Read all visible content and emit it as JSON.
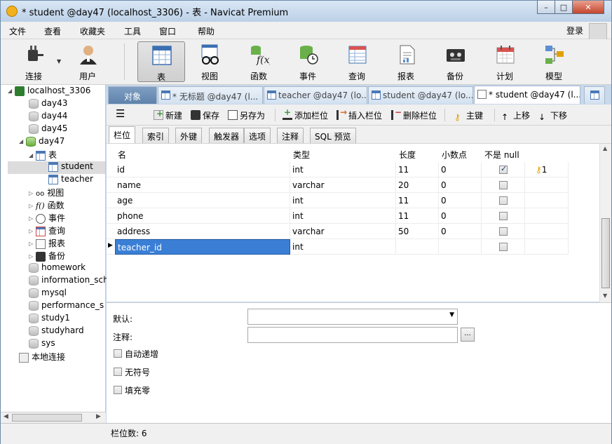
{
  "title": "* student @day47 (localhost_3306) - 表 - Navicat Premium",
  "window_controls": {
    "minimize": "–",
    "maximize": "□",
    "close": "✕"
  },
  "menu": [
    "文件",
    "查看",
    "收藏夹",
    "工具",
    "窗口",
    "帮助"
  ],
  "login_label": "登录",
  "toolbar": [
    "连接",
    "用户",
    "表",
    "视图",
    "函数",
    "事件",
    "查询",
    "报表",
    "备份",
    "计划",
    "模型"
  ],
  "toolbar_active": "表",
  "tree": {
    "connection": "localhost_3306",
    "databases_before": [
      "day43",
      "day44",
      "day45"
    ],
    "current_db": "day47",
    "tables_node": "表",
    "tables": [
      "student",
      "teacher"
    ],
    "selected_table": "student",
    "db_nodes": [
      "视图",
      "函数",
      "事件",
      "查询",
      "报表",
      "备份"
    ],
    "databases_after": [
      "homework",
      "information_sch",
      "mysql",
      "performance_s",
      "study1",
      "studyhard",
      "sys"
    ],
    "local": "本地连接"
  },
  "tabs": [
    {
      "label": "对象"
    },
    {
      "label": "* 无标题 @day47 (l..."
    },
    {
      "label": "teacher @day47 (lo..."
    },
    {
      "label": "student @day47 (lo..."
    },
    {
      "label": "* student @day47 (l..."
    }
  ],
  "content_toolbar": {
    "new": "新建",
    "save": "保存",
    "save_as": "另存为",
    "add_field": "添加栏位",
    "insert_field": "插入栏位",
    "delete_field": "删除栏位",
    "primary_key": "主键",
    "move_up": "上移",
    "move_down": "下移"
  },
  "subtabs": [
    "栏位",
    "索引",
    "外键",
    "触发器",
    "选项",
    "注释",
    "SQL 预览"
  ],
  "grid": {
    "headers": [
      "名",
      "类型",
      "长度",
      "小数点",
      "不是 null",
      ""
    ],
    "rows": [
      {
        "name": "id",
        "type": "int",
        "length": "11",
        "decimals": "0",
        "not_null": true,
        "key": "1"
      },
      {
        "name": "name",
        "type": "varchar",
        "length": "20",
        "decimals": "0",
        "not_null": false,
        "key": ""
      },
      {
        "name": "age",
        "type": "int",
        "length": "11",
        "decimals": "0",
        "not_null": false,
        "key": ""
      },
      {
        "name": "phone",
        "type": "int",
        "length": "11",
        "decimals": "0",
        "not_null": false,
        "key": ""
      },
      {
        "name": "address",
        "type": "varchar",
        "length": "50",
        "decimals": "0",
        "not_null": false,
        "key": ""
      },
      {
        "name": "teacher_id",
        "type": "int",
        "length": "",
        "decimals": "",
        "not_null": false,
        "key": ""
      }
    ],
    "editing_row": "teacher_id"
  },
  "props": {
    "default_label": "默认:",
    "comment_label": "注释:",
    "ellipsis": "...",
    "auto_increment": "自动递增",
    "unsigned": "无符号",
    "zerofill": "填充零"
  },
  "status": "栏位数: 6",
  "colors": {
    "accent": "#3a7fd5",
    "selection": "#3a7fd5",
    "key": "#e0a000"
  }
}
